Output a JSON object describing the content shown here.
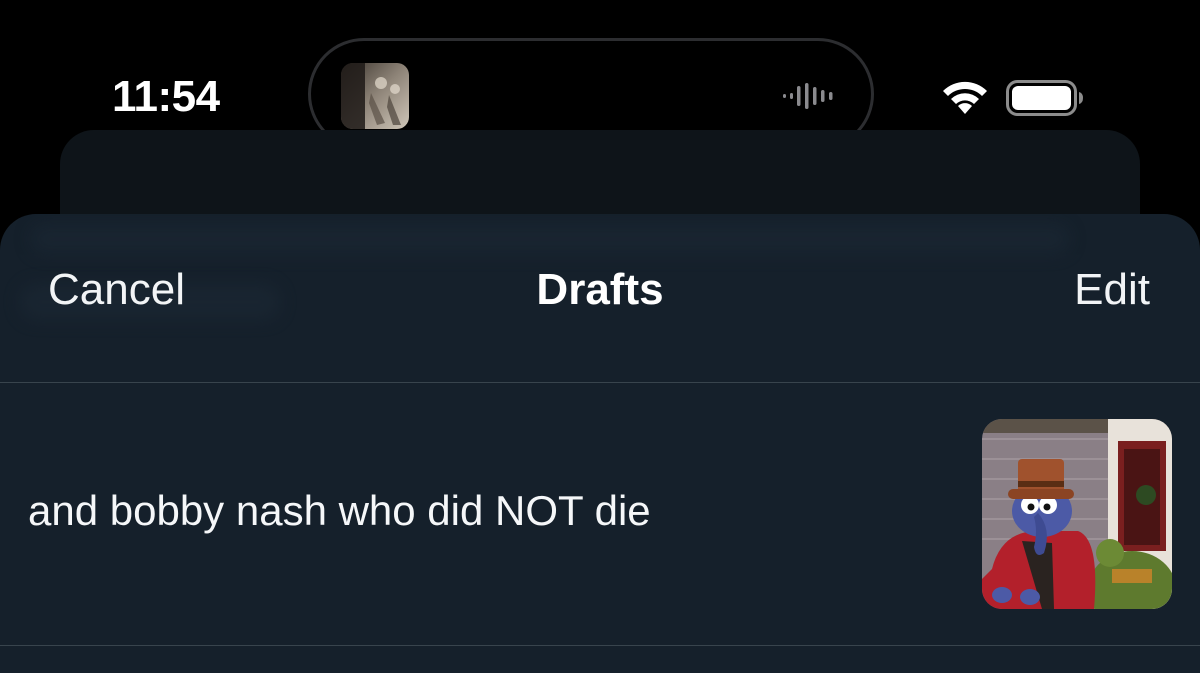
{
  "status_bar": {
    "time": "11:54",
    "icons": [
      "album-art-icon",
      "audio-waveform-icon",
      "wifi-icon",
      "battery-icon"
    ]
  },
  "sheet": {
    "header": {
      "cancel_label": "Cancel",
      "title": "Drafts",
      "edit_label": "Edit"
    },
    "drafts": [
      {
        "text": "and bobby nash who did NOT die",
        "thumbnail_icon": "gonzo-thumbnail-icon"
      }
    ]
  },
  "colors": {
    "sheet_background": "#15202b",
    "divider": "#38444d",
    "text": "#ffffff"
  }
}
